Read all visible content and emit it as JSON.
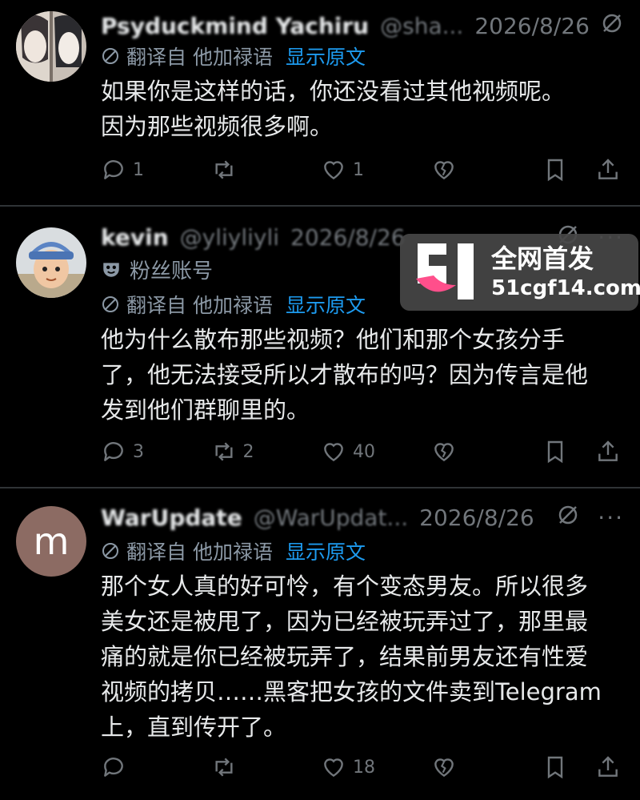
{
  "tweets": [
    {
      "name": "Psyduckmind Yachiru",
      "handle": "@sha...",
      "date": "2026/8/26",
      "translate_prefix": "翻译自 他加禄语",
      "translate_link": "显示原文",
      "text": "如果你是这样的话，你还没看过其他视频呢。\n因为那些视频很多啊。",
      "stats": {
        "replies": "1",
        "reposts": "",
        "likes": "1"
      }
    },
    {
      "name": "kevin",
      "handle": "@yliyliyli",
      "date": "2026/8/26",
      "fan_label": "粉丝账号",
      "translate_prefix": "翻译自 他加禄语",
      "translate_link": "显示原文",
      "text": "他为什么散布那些视频？他们和那个女孩分手\n了，他无法接受所以才散布的吗？因为传言是他\n发到他们群聊里的。",
      "stats": {
        "replies": "3",
        "reposts": "2",
        "likes": "40"
      }
    },
    {
      "name": "WarUpdate",
      "handle": "@WarUpdat...",
      "date": "2026/8/26",
      "avatar_letter": "m",
      "translate_prefix": "翻译自 他加禄语",
      "translate_link": "显示原文",
      "text": "那个女人真的好可怜，有个变态男友。所以很多\n美女还是被甩了，因为已经被玩弄过了，那里最\n痛的就是你已经被玩弄了，结果前男友还有性爱\n视频的拷贝……黑客把女孩的文件卖到Telegram\n上，直到传开了。",
      "stats": {
        "replies": "",
        "reposts": "",
        "likes": "18"
      }
    }
  ],
  "watermark": {
    "line1": "全网首发",
    "line2": "51cgf14.com",
    "accent": "#ff4f8b"
  },
  "colors": {
    "bg": "#000000",
    "text": "#e7e9ea",
    "muted": "#71767b",
    "link": "#1d9bf0"
  },
  "more_label": "···"
}
